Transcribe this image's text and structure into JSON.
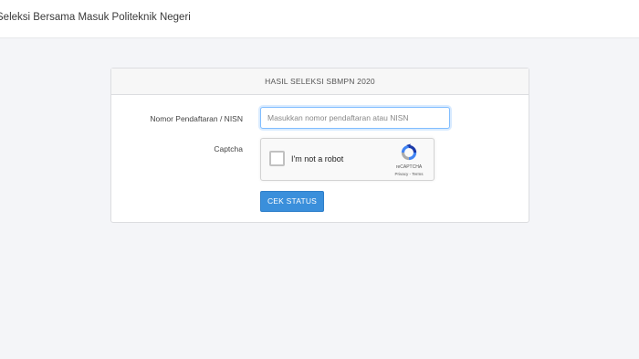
{
  "navbar": {
    "brand_text": "Seleksi Bersama Masuk Politeknik Negeri"
  },
  "card": {
    "header_title": "HASIL SELEKSI SBMPN 2020",
    "form": {
      "nomor_label": "Nomor Pendaftaran / NISN",
      "nomor_value": "",
      "nomor_placeholder": "Masukkan nomor pendaftaran atau NISN",
      "captcha_label": "Captcha",
      "recaptcha": {
        "checkbox_text": "I'm not a robot",
        "brand": "reCAPTCHA",
        "privacy_link": "Privacy",
        "separator": " - ",
        "terms_link": "Terms",
        "checked": false
      },
      "submit_label": "CEK STATUS"
    }
  },
  "colors": {
    "page_background": "#f4f5f8",
    "card_header_background": "#f7f7f7",
    "button_primary": "#3a8fdb",
    "input_focus_border": "#80bdff",
    "recaptcha_blue": "#1c3aa9",
    "recaptcha_light_blue": "#4285f4",
    "recaptcha_grey": "#ababab"
  }
}
